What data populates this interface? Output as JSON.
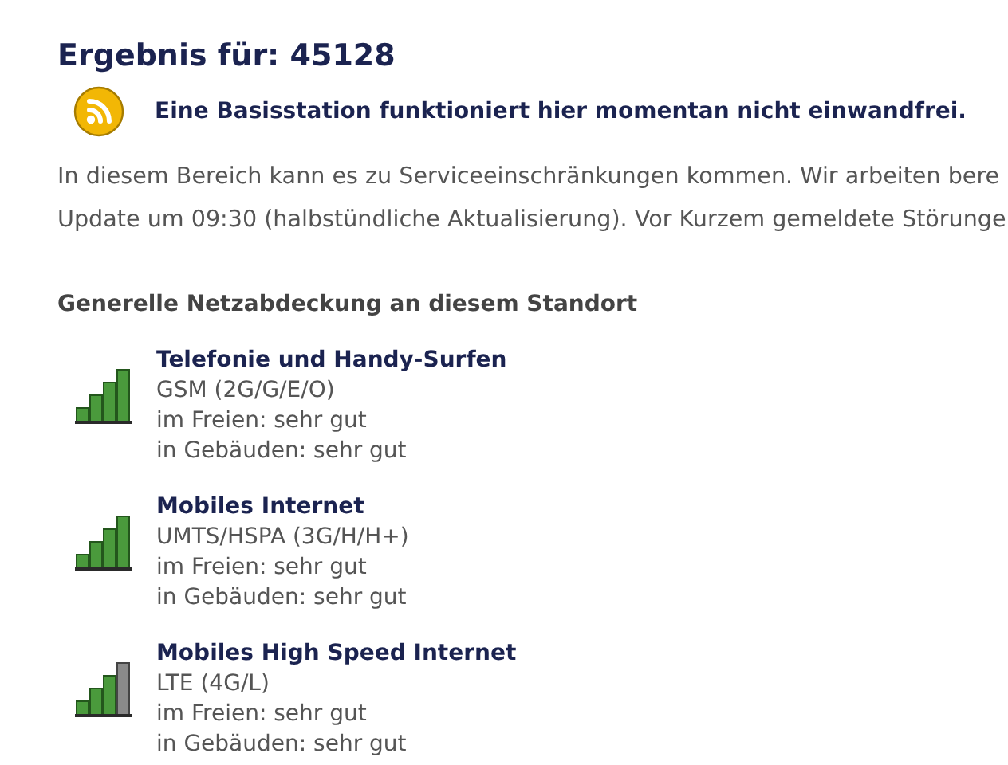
{
  "heading": "Ergebnis für: 45128",
  "alert": {
    "text": "Eine Basisstation funktioniert hier momentan nicht einwandfrei."
  },
  "paragraph_lines": [
    "In diesem Bereich kann es zu Serviceeinschränkungen kommen. Wir arbeiten bere",
    "Update um 09:30 (halbstündliche Aktualisierung). Vor Kurzem gemeldete Störunge"
  ],
  "coverage": {
    "title": "Generelle Netzabdeckung an diesem Standort",
    "items": [
      {
        "title": "Telefonie und Handy-Surfen",
        "technology": "GSM (2G/G/E/O)",
        "outdoor": "im Freien: sehr gut",
        "indoor": "in Gebäuden: sehr gut",
        "bars": [
          {
            "on": true
          },
          {
            "on": true
          },
          {
            "on": true
          },
          {
            "on": true
          }
        ]
      },
      {
        "title": "Mobiles Internet",
        "technology": "UMTS/HSPA (3G/H/H+)",
        "outdoor": "im Freien: sehr gut",
        "indoor": "in Gebäuden: sehr gut",
        "bars": [
          {
            "on": true
          },
          {
            "on": true
          },
          {
            "on": true
          },
          {
            "on": true
          }
        ]
      },
      {
        "title": "Mobiles High Speed Internet",
        "technology": "LTE (4G/L)",
        "outdoor": "im Freien: sehr gut",
        "indoor": "in Gebäuden: sehr gut",
        "bars": [
          {
            "on": true
          },
          {
            "on": true
          },
          {
            "on": true
          },
          {
            "on": false
          }
        ]
      }
    ]
  }
}
